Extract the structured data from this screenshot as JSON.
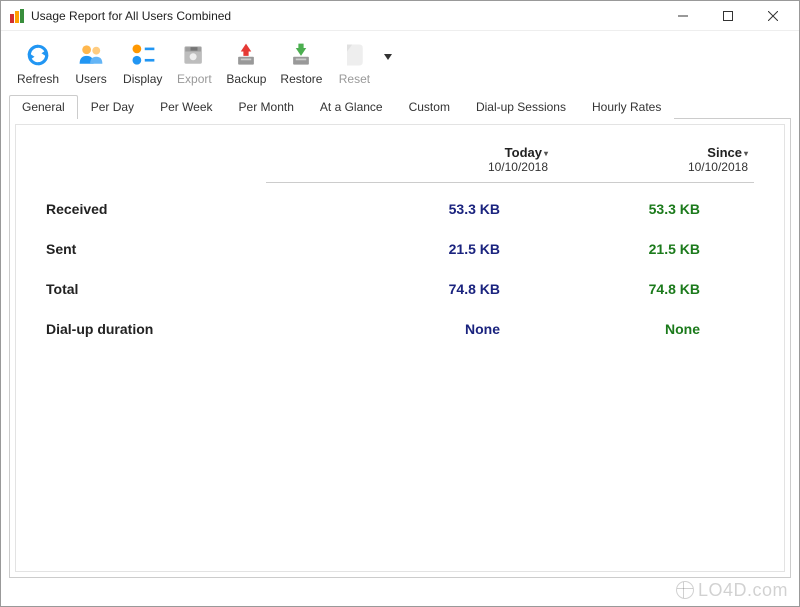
{
  "window": {
    "title": "Usage Report for All Users Combined"
  },
  "toolbar": {
    "refresh": "Refresh",
    "users": "Users",
    "display": "Display",
    "export": "Export",
    "backup": "Backup",
    "restore": "Restore",
    "reset": "Reset"
  },
  "tabs": {
    "general": "General",
    "per_day": "Per Day",
    "per_week": "Per Week",
    "per_month": "Per Month",
    "at_a_glance": "At a Glance",
    "custom": "Custom",
    "dial_up": "Dial-up Sessions",
    "hourly": "Hourly Rates"
  },
  "report": {
    "columns": {
      "today": {
        "title": "Today",
        "date": "10/10/2018"
      },
      "since": {
        "title": "Since",
        "date": "10/10/2018"
      }
    },
    "rows": {
      "received": {
        "label": "Received",
        "today": "53.3 KB",
        "since": "53.3 KB"
      },
      "sent": {
        "label": "Sent",
        "today": "21.5 KB",
        "since": "21.5 KB"
      },
      "total": {
        "label": "Total",
        "today": "74.8 KB",
        "since": "74.8 KB"
      },
      "dialup": {
        "label": "Dial-up duration",
        "today": "None",
        "since": "None"
      }
    }
  },
  "watermark": "LO4D.com"
}
